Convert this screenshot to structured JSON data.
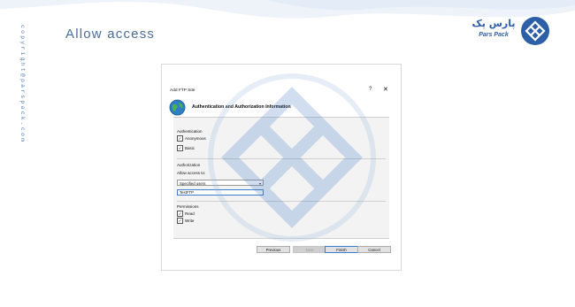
{
  "page": {
    "vertical_copyright": "copyright@parspack.com",
    "title": "Allow access"
  },
  "brand": {
    "name_fa": "پارس پک",
    "name_en": "Pars Pack",
    "accent_color": "#2d5fa8"
  },
  "dialog": {
    "window_title": "Add FTP Site",
    "help_glyph": "?",
    "close_glyph": "✕",
    "heading": "Authentication and Authorization Information",
    "authentication": {
      "label": "Authentication",
      "anonymous": {
        "label": "Anonymous",
        "checked": true
      },
      "basic": {
        "label": "Basic",
        "checked": true
      }
    },
    "authorization": {
      "label": "Authorization",
      "allow_access_label": "Allow access to:",
      "allow_access_value": "Specified users",
      "user_input_value": "TestFTP"
    },
    "permissions": {
      "label": "Permissions",
      "read": {
        "label": "Read",
        "checked": true
      },
      "write": {
        "label": "Write",
        "checked": true
      }
    },
    "buttons": {
      "previous": "Previous",
      "next": "Next",
      "finish": "Finish",
      "cancel": "Cancel"
    }
  }
}
